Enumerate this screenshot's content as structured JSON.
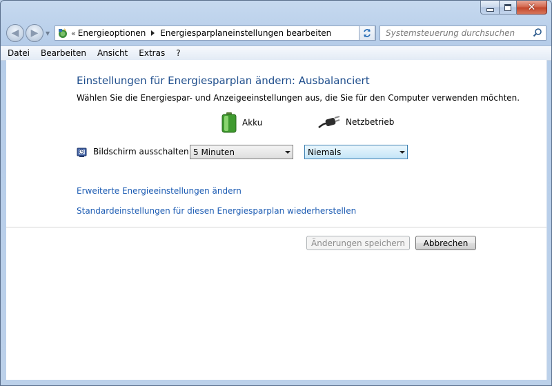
{
  "window": {
    "caption_buttons": [
      "minimize",
      "maximize",
      "close"
    ]
  },
  "navigation": {
    "back_icon": "back-arrow-icon",
    "forward_icon": "forward-arrow-icon",
    "address": {
      "overflow": "«",
      "crumbs": [
        "Energieoptionen",
        "Energiesparplaneinstellungen bearbeiten"
      ]
    },
    "search_placeholder": "Systemsteuerung durchsuchen"
  },
  "menu": [
    "Datei",
    "Bearbeiten",
    "Ansicht",
    "Extras",
    "?"
  ],
  "main": {
    "heading": "Einstellungen für Energiesparplan ändern: Ausbalanciert",
    "subtitle": "Wählen Sie die Energiespar- und Anzeigeeinstellungen aus, die Sie für den Computer verwenden möchten.",
    "columns": {
      "battery": "Akku",
      "ac": "Netzbetrieb"
    },
    "setting": {
      "label": "Bildschirm ausschalten:",
      "battery_value": "5 Minuten",
      "ac_value": "Niemals"
    },
    "links": [
      "Erweiterte Energieeinstellungen ändern",
      "Standardeinstellungen für diesen Energiesparplan wiederherstellen"
    ],
    "buttons": {
      "save": "Änderungen speichern",
      "cancel": "Abbrechen"
    }
  },
  "colors": {
    "heading": "#1f4e8c",
    "link": "#1d5cb3",
    "window_frame": "#bcd0e8",
    "close_button": "#c3472c"
  }
}
